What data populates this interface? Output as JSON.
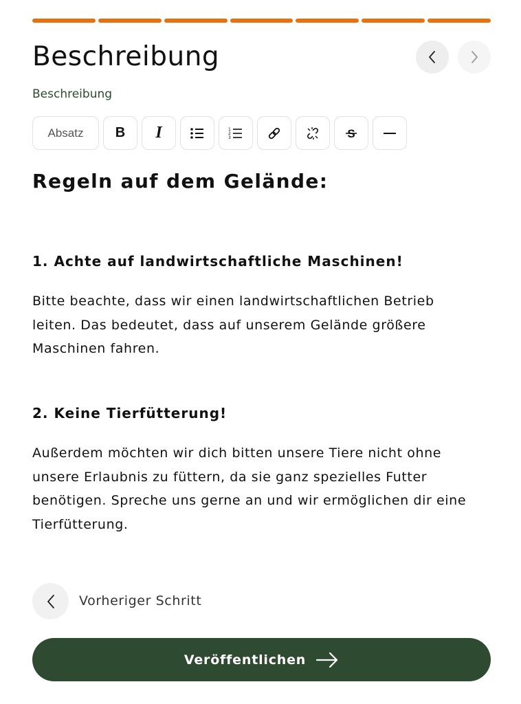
{
  "colors": {
    "progress": "#e8710f",
    "brand_green": "#2e4a30",
    "text": "#111111"
  },
  "progress": {
    "total_steps": 7,
    "completed_steps": 7
  },
  "header": {
    "title": "Beschreibung",
    "prev_icon": "chevron-left-icon",
    "next_icon": "chevron-right-icon"
  },
  "field": {
    "label": "Beschreibung"
  },
  "toolbar": {
    "paragraph_label": "Absatz",
    "bold_label": "B",
    "italic_label": "I",
    "icons": [
      "bullet-list-icon",
      "numbered-list-icon",
      "link-icon",
      "unlink-icon",
      "strikethrough-icon",
      "horizontal-rule-icon"
    ]
  },
  "content": {
    "heading": "Regeln auf dem Gelände:",
    "sections": [
      {
        "title": "1. Achte auf landwirtschaftliche Maschinen!",
        "lines": [
          "Bitte beachte, dass wir einen landwirtschaftlichen Betrieb",
          "leiten. Das bedeutet, dass auf unserem Gelände größere",
          "Maschinen fahren."
        ]
      },
      {
        "title": "2. Keine Tierfütterung!",
        "lines": [
          "Außerdem möchten wir dich bitten unsere Tiere nicht ohne",
          "unsere Erlaubnis zu füttern, da sie ganz spezielles Futter",
          "benötigen. Spreche uns gerne an und wir ermöglichen dir eine",
          "Tierfütterung."
        ]
      }
    ]
  },
  "footer": {
    "back_label": "Vorheriger Schritt",
    "publish_label": "Veröffentlichen",
    "publish_icon": "arrow-right-icon"
  }
}
